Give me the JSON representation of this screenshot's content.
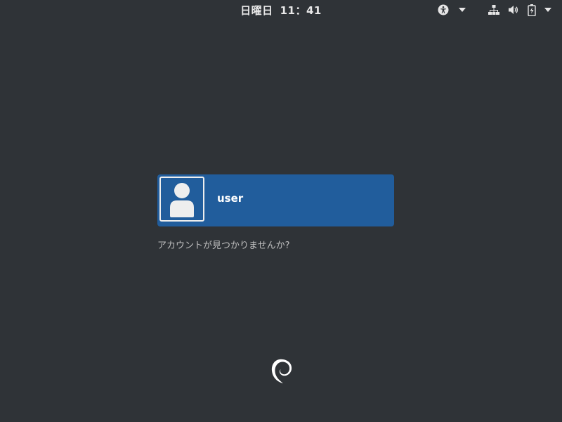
{
  "topbar": {
    "day": "日曜日",
    "time": "11：41",
    "icons": {
      "accessibility": "accessibility-icon",
      "network": "network-wired-icon",
      "volume": "volume-icon",
      "battery": "battery-charging-icon",
      "dropdown": "chevron-down-icon"
    }
  },
  "login": {
    "users": [
      {
        "name": "user",
        "avatar": "default-user-avatar-icon"
      }
    ],
    "not_listed_label": "アカウントが見つかりませんか?"
  },
  "branding": {
    "logo": "debian-swirl-logo"
  },
  "colors": {
    "background": "#2f3337",
    "user_card": "#215d9c",
    "text": "#ffffff",
    "muted_text": "#bfbfbf"
  }
}
